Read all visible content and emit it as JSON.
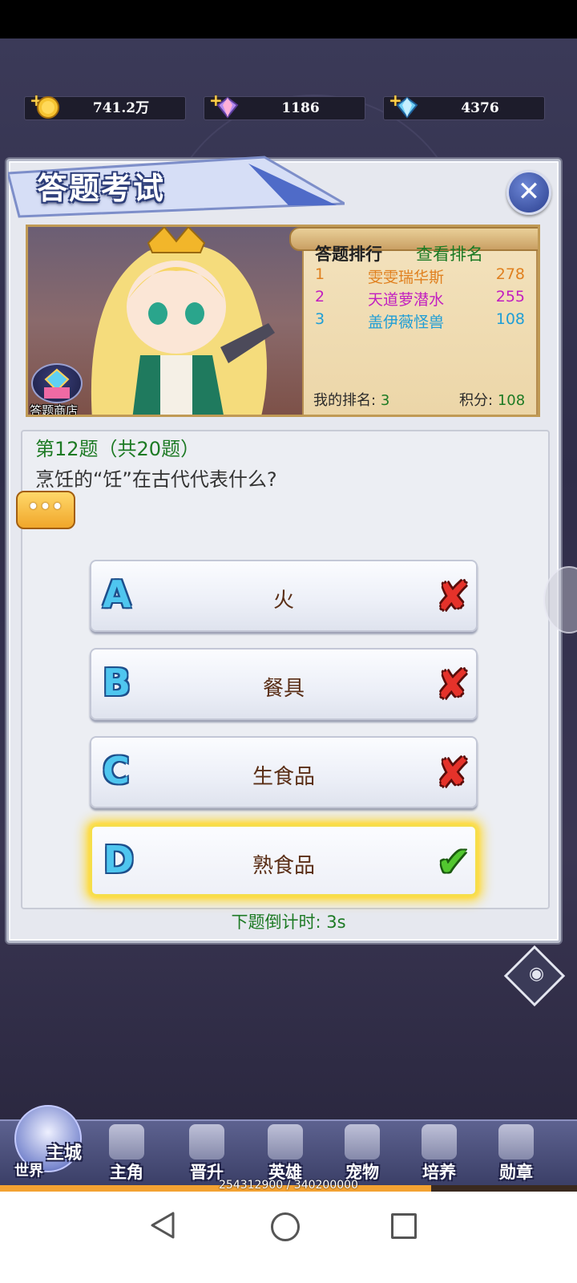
{
  "currency": {
    "gold": "741.2万",
    "crystal": "1186",
    "diamond": "4376"
  },
  "dialog": {
    "title": "答题考试",
    "close_icon": "close-icon"
  },
  "ranking": {
    "title": "答题排行",
    "view_label": "查看排名",
    "entries": [
      {
        "rank": "1",
        "name": "雯雯瑞华斯",
        "score": "278",
        "color": "#e0801f"
      },
      {
        "rank": "2",
        "name": "天道萝潜水",
        "score": "255",
        "color": "#c21fc0"
      },
      {
        "rank": "3",
        "name": "盖伊薇怪兽",
        "score": "108",
        "color": "#1f9ed6"
      }
    ],
    "my_rank_label": "我的排名:",
    "my_rank_value": "3",
    "score_label": "积分:",
    "score_value": "108"
  },
  "shop": {
    "label": "答题商店"
  },
  "question": {
    "number": "第12题（共20题）",
    "text": "烹饪的“饪”在古代代表什么?",
    "bubble": "•••"
  },
  "options": [
    {
      "letter": "A",
      "label": "火",
      "result": "wrong"
    },
    {
      "letter": "B",
      "label": "餐具",
      "result": "wrong"
    },
    {
      "letter": "C",
      "label": "生食品",
      "result": "wrong"
    },
    {
      "letter": "D",
      "label": "熟食品",
      "result": "right"
    }
  ],
  "countdown": "下题倒计时: 3s",
  "nav": {
    "main_city": "主城",
    "world": "世界",
    "items": [
      "主角",
      "晋升",
      "英雄",
      "宠物",
      "培养",
      "勋章"
    ]
  },
  "exp": {
    "text": "254312900 / 340200000",
    "progress": 0.7475
  },
  "colors": {
    "accent_green": "#1d7a24",
    "wrong_red": "#e5322a",
    "right_green": "#52c72f",
    "highlight_gold": "#f6de4a"
  }
}
